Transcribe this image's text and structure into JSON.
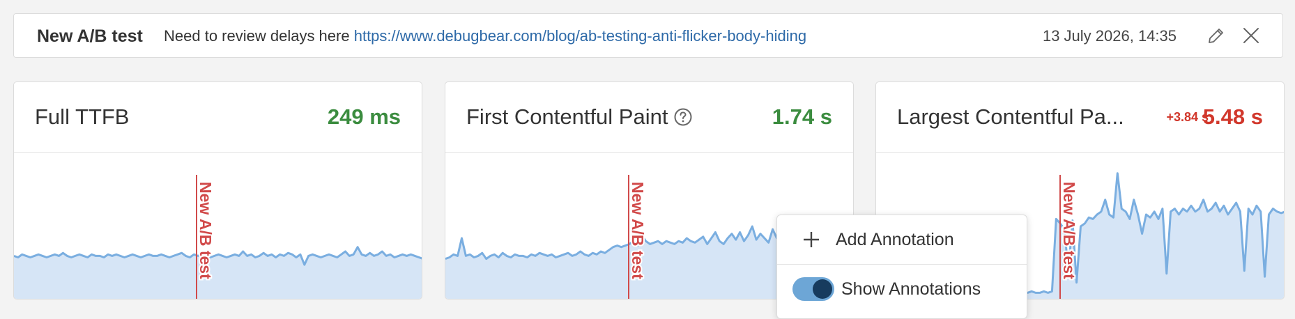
{
  "annotation": {
    "title": "New A/B test",
    "description": "Need to review delays here",
    "link": "https://www.debugbear.com/blog/ab-testing-anti-flicker-body-hiding",
    "date": "13 July 2026, 14:35"
  },
  "cards": [
    {
      "title": "Full TTFB",
      "value": "249 ms",
      "value_color": "#3b8c3f",
      "marker_label": "New A/B test",
      "series": [
        0.3,
        0.29,
        0.31,
        0.3,
        0.29,
        0.3,
        0.31,
        0.3,
        0.29,
        0.3,
        0.31,
        0.3,
        0.32,
        0.3,
        0.29,
        0.3,
        0.31,
        0.3,
        0.29,
        0.31,
        0.3,
        0.3,
        0.29,
        0.31,
        0.3,
        0.31,
        0.3,
        0.29,
        0.3,
        0.31,
        0.3,
        0.29,
        0.3,
        0.31,
        0.3,
        0.3,
        0.31,
        0.3,
        0.29,
        0.3,
        0.31,
        0.32,
        0.3,
        0.29,
        0.31,
        0.3,
        0.31,
        0.3,
        0.29,
        0.3,
        0.31,
        0.3,
        0.29,
        0.3,
        0.31,
        0.3,
        0.33,
        0.3,
        0.31,
        0.29,
        0.3,
        0.32,
        0.3,
        0.31,
        0.29,
        0.31,
        0.3,
        0.32,
        0.31,
        0.29,
        0.31,
        0.24,
        0.3,
        0.31,
        0.3,
        0.29,
        0.3,
        0.31,
        0.3,
        0.29,
        0.31,
        0.33,
        0.3,
        0.31,
        0.36,
        0.31,
        0.3,
        0.32,
        0.3,
        0.31,
        0.33,
        0.3,
        0.31,
        0.29,
        0.3,
        0.31,
        0.3,
        0.31,
        0.3,
        0.29,
        0.28
      ]
    },
    {
      "title": "First Contentful Paint",
      "value": "1.74 s",
      "value_color": "#3b8c3f",
      "help": true,
      "marker_label": "New A/B test",
      "series": [
        0.28,
        0.29,
        0.31,
        0.3,
        0.42,
        0.3,
        0.31,
        0.29,
        0.3,
        0.32,
        0.28,
        0.3,
        0.31,
        0.29,
        0.32,
        0.3,
        0.29,
        0.31,
        0.3,
        0.3,
        0.29,
        0.31,
        0.3,
        0.32,
        0.31,
        0.3,
        0.31,
        0.29,
        0.3,
        0.31,
        0.32,
        0.3,
        0.31,
        0.33,
        0.31,
        0.3,
        0.32,
        0.31,
        0.33,
        0.32,
        0.34,
        0.36,
        0.37,
        0.36,
        0.37,
        0.38,
        0.4,
        0.37,
        0.44,
        0.4,
        0.38,
        0.39,
        0.4,
        0.38,
        0.4,
        0.39,
        0.38,
        0.4,
        0.39,
        0.42,
        0.4,
        0.39,
        0.41,
        0.43,
        0.38,
        0.42,
        0.46,
        0.4,
        0.38,
        0.42,
        0.45,
        0.41,
        0.46,
        0.4,
        0.44,
        0.5,
        0.41,
        0.45,
        0.42,
        0.39,
        0.48,
        0.42,
        0.44,
        0.42,
        0.4,
        0.44,
        0.46,
        0.43,
        0.42,
        0.45,
        0.44,
        0.43,
        0.42,
        0.44,
        0.43,
        0.45,
        0.42,
        0.44,
        0.43,
        0.42,
        0.44
      ]
    },
    {
      "title": "Largest Contentful Pa...",
      "value": "5.48 s",
      "value_color": "#d1372b",
      "delta": "+3.84 s",
      "marker_label": "New A/B test",
      "series": [
        0.05,
        0.05,
        0.06,
        0.05,
        0.05,
        0.06,
        0.05,
        0.05,
        0.06,
        0.05,
        0.05,
        0.06,
        0.05,
        0.05,
        0.06,
        0.05,
        0.05,
        0.06,
        0.05,
        0.05,
        0.06,
        0.05,
        0.05,
        0.06,
        0.05,
        0.05,
        0.06,
        0.05,
        0.05,
        0.06,
        0.05,
        0.05,
        0.06,
        0.05,
        0.05,
        0.06,
        0.05,
        0.05,
        0.06,
        0.05,
        0.05,
        0.06,
        0.05,
        0.06,
        0.55,
        0.52,
        0.48,
        0.2,
        0.54,
        0.12,
        0.5,
        0.52,
        0.56,
        0.55,
        0.58,
        0.6,
        0.68,
        0.58,
        0.56,
        0.86,
        0.62,
        0.6,
        0.55,
        0.68,
        0.58,
        0.45,
        0.58,
        0.56,
        0.6,
        0.55,
        0.62,
        0.18,
        0.6,
        0.62,
        0.58,
        0.62,
        0.6,
        0.64,
        0.6,
        0.62,
        0.68,
        0.6,
        0.62,
        0.66,
        0.6,
        0.64,
        0.58,
        0.62,
        0.66,
        0.6,
        0.2,
        0.62,
        0.58,
        0.64,
        0.6,
        0.16,
        0.58,
        0.62,
        0.6,
        0.59,
        0.6
      ]
    }
  ],
  "menu": {
    "add_label": "Add Annotation",
    "show_label": "Show Annotations",
    "show_enabled": true
  }
}
